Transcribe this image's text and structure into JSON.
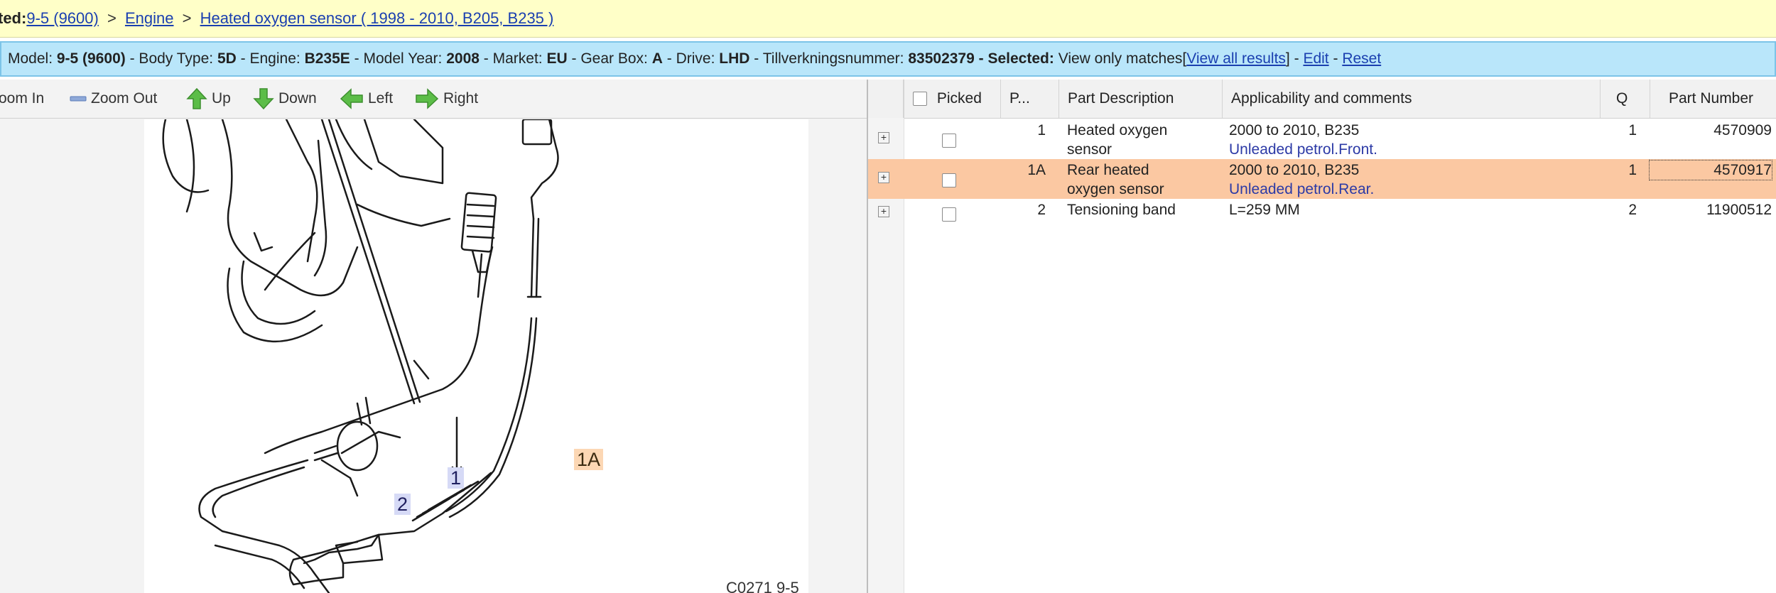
{
  "breadcrumb": {
    "lead": "ted:",
    "model_link": "9-5 (9600)",
    "sep1": ">",
    "section_link": "Engine",
    "sep2": ">",
    "page_link": "Heated oxygen sensor ( 1998 - 2010, B205, B235 )"
  },
  "vehicle": {
    "model_label": "Model:",
    "model": "9-5 (9600)",
    "body_label": "- Body Type:",
    "body": "5D",
    "engine_label": "- Engine:",
    "engine": "B235E",
    "year_label": "- Model Year:",
    "year": "2008",
    "market_label": "- Market:",
    "market": "EU",
    "gearbox_label": "- Gear Box:",
    "gearbox": "A",
    "drive_label": "- Drive:",
    "drive": "LHD",
    "tvn_label": "- Tillverkningsnummer:",
    "tvn": "83502379",
    "selected_label": "- Selected:",
    "selected": "View only matches",
    "view_all_open": "[",
    "view_all_link": "View all results",
    "view_all_close": "]",
    "dash1": "-",
    "edit_link": "Edit",
    "dash2": "-",
    "reset_link": "Reset"
  },
  "toolbar": {
    "zoom_in": "oom In",
    "zoom_out": "Zoom Out",
    "up": "Up",
    "down": "Down",
    "left": "Left",
    "right": "Right"
  },
  "illustration": {
    "callouts": {
      "c1": "1",
      "c2": "2",
      "c1a": "1A"
    },
    "figure_code": "C0271 9-5"
  },
  "table": {
    "headers": {
      "picked": "Picked",
      "pos": "P...",
      "desc": "Part Description",
      "appl": "Applicability and comments",
      "qty": "Q",
      "pn": "Part Number"
    },
    "rows": [
      {
        "pos": "1",
        "desc1": "Heated oxygen",
        "desc2": "sensor",
        "appl1": "2000 to 2010, B235",
        "appl2": "Unleaded petrol.Front.",
        "qty": "1",
        "pn": "4570909",
        "expand": "+"
      },
      {
        "pos": "1A",
        "desc1": "Rear heated",
        "desc2": "oxygen sensor",
        "appl1": "2000 to 2010, B235",
        "appl2": "Unleaded petrol.Rear.",
        "qty": "1",
        "pn": "4570917",
        "expand": "+"
      },
      {
        "pos": "2",
        "desc1": "Tensioning band",
        "desc2": "",
        "appl1": "L=259 MM",
        "appl2": "",
        "qty": "2",
        "pn": "11900512",
        "expand": "+"
      }
    ]
  },
  "colors": {
    "breadcrumb_bg": "#ffffc8",
    "infobar_bg": "#b9e6fa",
    "highlight_row": "#fbc8a2",
    "link": "#1a3fb0",
    "arrow_green": "#4caf3c"
  }
}
